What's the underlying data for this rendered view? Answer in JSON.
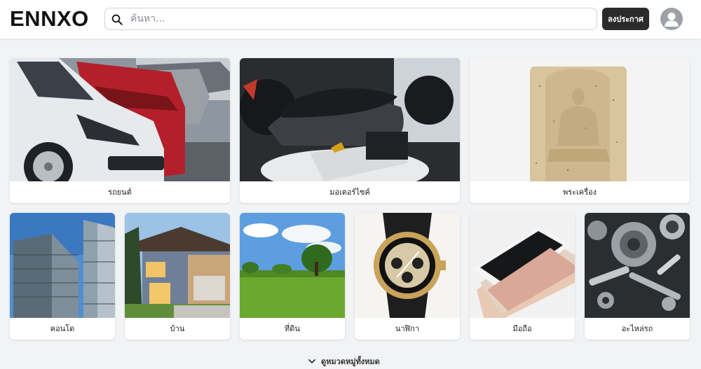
{
  "header": {
    "logo_text": "ENNXO",
    "search_placeholder": "ค้นหา...",
    "post_button_label": "ลงประกาศ"
  },
  "categories_top": [
    {
      "label": "รถยนต์",
      "icon": "car-photo"
    },
    {
      "label": "มอเตอร์ไซค์",
      "icon": "motorcycle-photo"
    },
    {
      "label": "พระเครื่อง",
      "icon": "amulet-photo"
    }
  ],
  "categories_bottom": [
    {
      "label": "คอนโด",
      "icon": "condo-photo"
    },
    {
      "label": "บ้าน",
      "icon": "house-photo"
    },
    {
      "label": "ที่ดิน",
      "icon": "land-photo"
    },
    {
      "label": "นาฬิกา",
      "icon": "watch-photo"
    },
    {
      "label": "มือถือ",
      "icon": "phone-photo"
    },
    {
      "label": "อะไหล่รถ",
      "icon": "car-parts-photo"
    }
  ],
  "see_all_label": "ดูหมวดหมู่ทั้งหมด",
  "colors": {
    "background": "#f2f3f5",
    "post_button": "#2b2b2b",
    "avatar": "#9ea2a7"
  }
}
